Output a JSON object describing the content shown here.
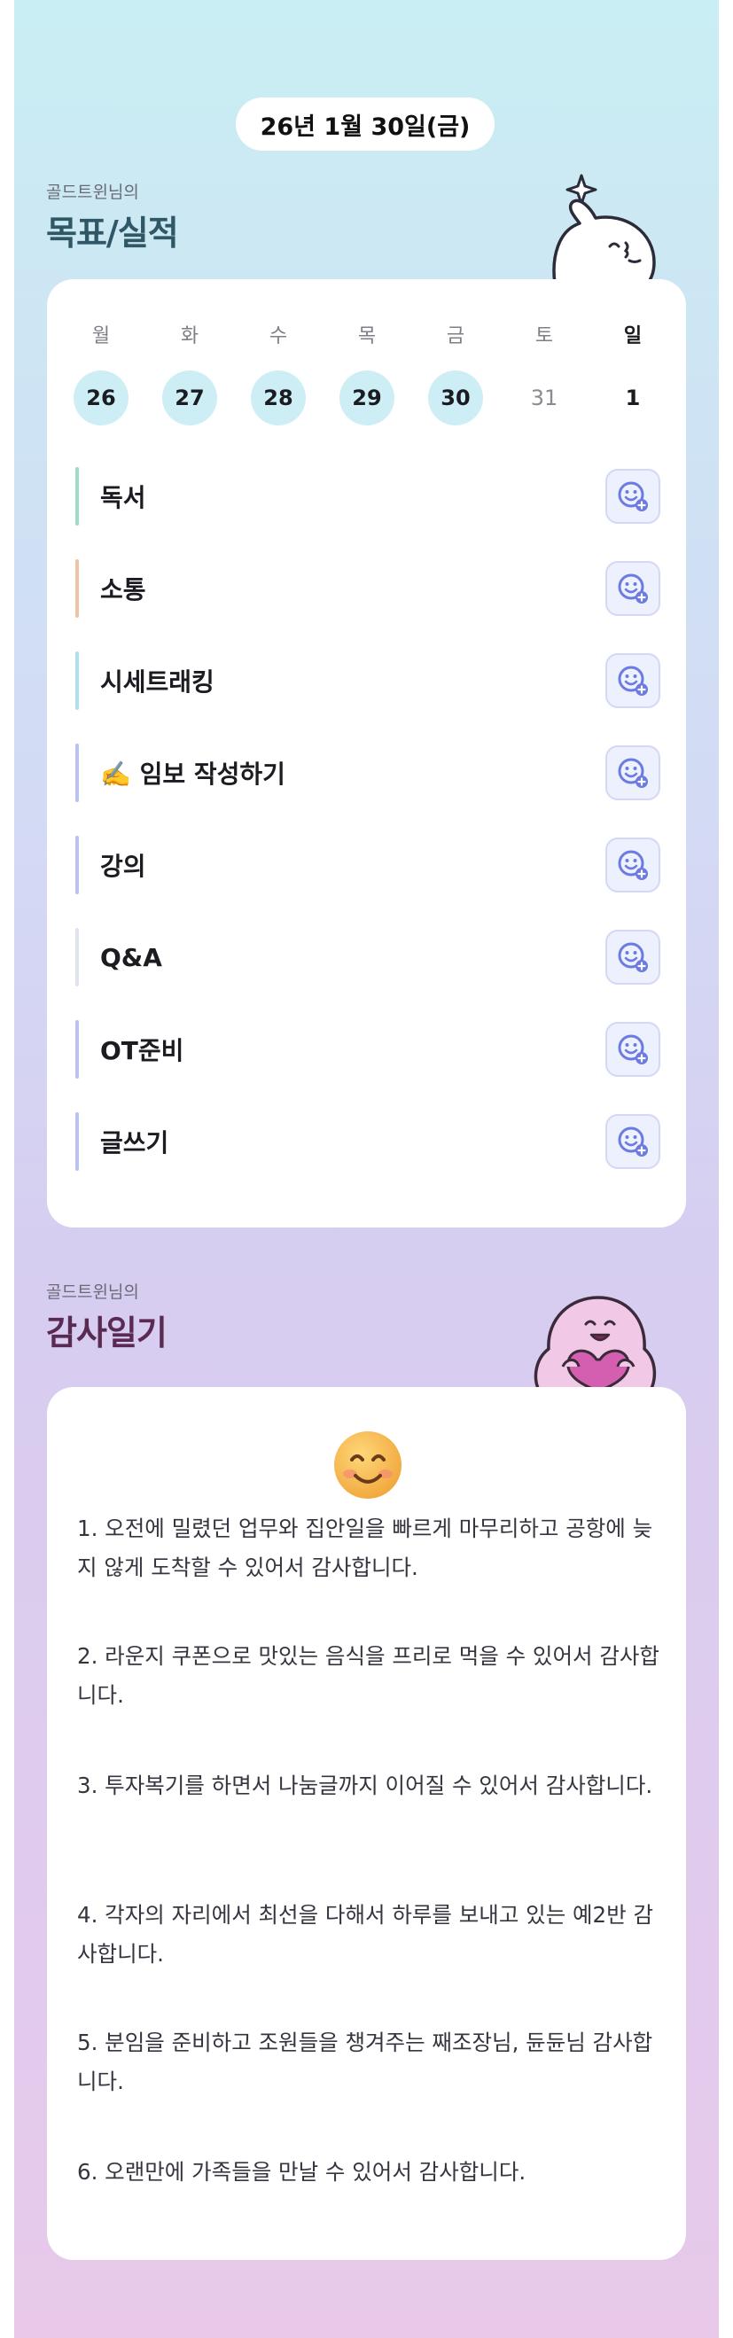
{
  "header": {
    "date": "26년 1월 30일(금)"
  },
  "goals_section": {
    "owner": "골드트윈님의",
    "title": "목표/실적"
  },
  "calendar": {
    "weekdays": [
      "월",
      "화",
      "수",
      "목",
      "금",
      "토",
      "일"
    ],
    "days": [
      "26",
      "27",
      "28",
      "29",
      "30",
      "31",
      "1"
    ],
    "completed_days": [
      "26",
      "27",
      "28",
      "29",
      "30"
    ]
  },
  "goals": [
    {
      "label": "독서",
      "bar_color": "#9fdcc6"
    },
    {
      "label": "소통",
      "bar_color": "#efc2a6"
    },
    {
      "label": "시세트래킹",
      "bar_color": "#aee0ee"
    },
    {
      "label": "✍️ 임보 작성하기",
      "bar_color": "#b9c2f2"
    },
    {
      "label": "강의",
      "bar_color": "#b9c2f2"
    },
    {
      "label": "Q&A",
      "bar_color": "#dfe3ee"
    },
    {
      "label": "OT준비",
      "bar_color": "#b9c2f2"
    },
    {
      "label": "글쓰기",
      "bar_color": "#b9c2f2"
    }
  ],
  "icons": {
    "goal_action": "smile-add-icon",
    "gratitude_emoji": "smiling-face-icon"
  },
  "gratitude_section": {
    "owner": "골드트윈님의",
    "title": "감사일기"
  },
  "gratitude_entries": [
    "1. 오전에 밀렸던 업무와 집안일을 빠르게 마무리하고 공항에 늦지 않게 도착할 수 있어서 감사합니다.",
    "2. 라운지 쿠폰으로 맛있는 음식을 프리로 먹을 수 있어서 감사합니다.",
    "3. 투자복기를 하면서 나눔글까지 이어질 수 있어서 감사합니다.",
    "4. 각자의 자리에서 최선을 다해서 하루를 보내고 있는 예2반 감사합니다.",
    "5. 분임을 준비하고 조원들을 챙겨주는 째조장님, 듄듄님 감사합니다.",
    "6. 오랜만에 가족들을 만날 수 있어서 감사합니다."
  ],
  "colors": {
    "goals_title": "#2f5766",
    "gratitude_title": "#5b2a52",
    "active_day": "#cdeef5",
    "smile_button_bg": "#edf0fd",
    "smile_icon": "#6b7be0"
  }
}
